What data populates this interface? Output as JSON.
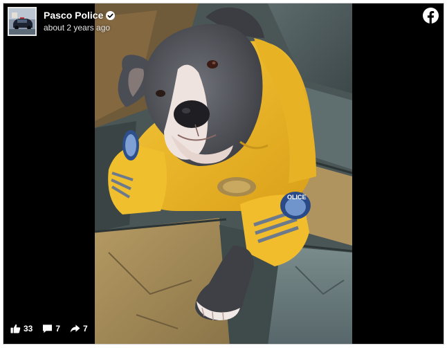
{
  "post": {
    "page_name": "Pasco Police",
    "timestamp": "about 2 years ago",
    "verified": true
  },
  "stats": {
    "likes": "33",
    "comments": "7",
    "shares": "7"
  },
  "icons": {
    "brand": "facebook-logo-icon",
    "verified": "verified-badge-icon",
    "like": "thumbs-up-icon",
    "comment": "comment-bubble-icon",
    "share": "share-arrow-icon"
  },
  "colors": {
    "background": "#000000",
    "text": "#ffffff",
    "verified_badge": "#ffffff",
    "uniform": "#f2b928"
  }
}
